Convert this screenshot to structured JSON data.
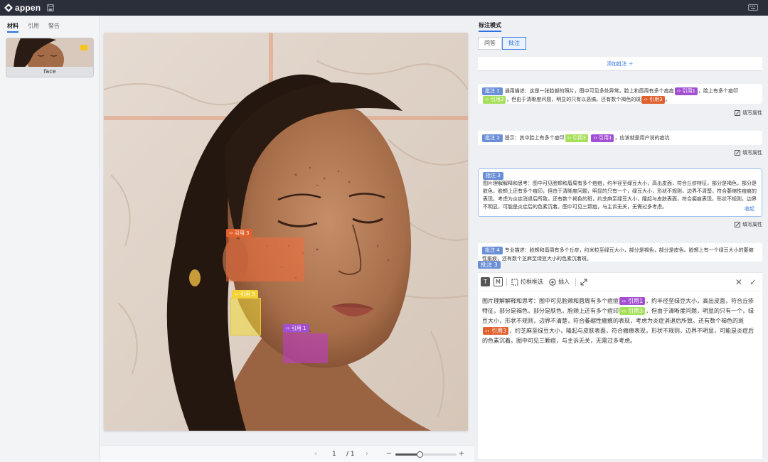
{
  "app": {
    "logo_text": "appen"
  },
  "left": {
    "tabs": [
      {
        "label": "材料",
        "active": true
      },
      {
        "label": "引用"
      },
      {
        "label": "警告"
      }
    ],
    "thumbnail_label": "face"
  },
  "canvas": {
    "annotations": [
      {
        "tag": "‹› 引用 3",
        "color": "#e0602e"
      },
      {
        "tag": "‹› 引用 3",
        "color": "#f2d235"
      },
      {
        "tag": "‹› 引用 1",
        "color": "#a34fd2"
      }
    ]
  },
  "pager": {
    "prev": "‹",
    "current": "1",
    "total": "/ 1",
    "next": "›",
    "zoom_minus": "−",
    "zoom_plus": "+",
    "zoom_level": 0.4
  },
  "right": {
    "title": "标注模式",
    "mode_tabs": [
      {
        "label": "问答"
      },
      {
        "label": "批注",
        "active": true
      }
    ],
    "add_note": "添加批注 ＋",
    "fill_attr_label": "填写属性",
    "notes": [
      {
        "badge": "批注 1",
        "parts": [
          "通用描述：这是一张脸部的照片，图中可见多处异常。脸上和唇周有多个痘痘",
          "，脸上有多个痘印",
          "，但由于清晰度问题，明显的只有以恶搞。还有数个褐色的斑",
          "。"
        ],
        "chips": [
          "‹› 引用1",
          "‹› 引用3",
          "‹› 引用3"
        ]
      },
      {
        "badge": "批注 2",
        "parts": [
          "提示：其中脸上有多个痘印",
          "",
          "，应该就是用户说的痘坑"
        ],
        "chips": [
          "‹› 引用3",
          "‹› 引用1"
        ]
      },
      {
        "badge": "批注 3",
        "text": "图片理解解释和思考：图中可见脸颊和唇周有多个痘痘，约半径至绿豆大小，高出皮面，符合丘疹特征，部分是褐色，部分是肤色，脸颊上还有多个痘印，但由于清晰度问题，明显的只有一个，绿豆大小，形状不规则，边界不清楚，符合萎缩性痘痕的表现，考虑为炎症消退后所致。还有数个褐色的斑，约芝麻至绿豆大小，隆起与皮肤表面，符合癜痕表现，形状不规则，边界不明显，可能是炎症后的色素沉着。图中可见三颗痘，与主诉无关，无需过多考虑。",
        "collapse": "收起"
      },
      {
        "badge": "批注 4",
        "text": "专业描述：脸颊和唇周有多个丘疹，约米粒至绿豆大小，部分是褐色，部分是皮色。脸颊上有一个绿豆大小的萎缩性瘢痕，还有数个芝麻至绿豆大小的色素沉着斑。"
      }
    ],
    "floating_badge": "批注 3",
    "editor": {
      "tool_text": "T",
      "tool_markdown": "M",
      "tool_box_select": "拉框框选",
      "tool_insert": "插入",
      "close": "✕",
      "confirm": "✓",
      "parts": [
        "图片理解解释和思考：图中可见脸颊和唇周有多个痘痘",
        "，约半径至绿豆大小，高出皮面，符合丘疹特征，部分是褐色，部分是肤色，脸颊上还有多个痘印",
        "，但由于清晰度问题，明显的只有一个，绿豆大小，形状不规则，边界不清楚，符合萎缩性瘢痕的表现，考虑为炎症消退后所致。还有数个褐色的斑",
        "，约芝麻至绿豆大小，隆起与皮肤表面，符合瘢痕表现，形状不规则，边界不明显，可能是炎症后的色素沉着。图中可见三颗痘，与主诉无关，无需过多考虑。"
      ],
      "chips": [
        "‹› 引用1",
        "‹› 引用3",
        "‹› 引用3"
      ]
    }
  }
}
